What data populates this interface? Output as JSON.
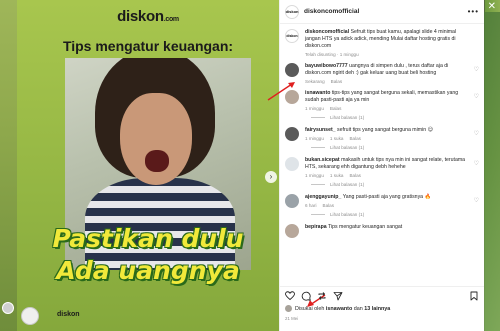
{
  "post": {
    "brand": "diskon",
    "brand_suffix": ".com",
    "headline": "Tips mengatur keuangan:",
    "caption_line1": "Pastikan dulu",
    "caption_line2": "Ada uangnya",
    "footer_brand": "diskon"
  },
  "header": {
    "username": "diskoncomofficial",
    "avatar_text": "diskon",
    "more": "•••"
  },
  "caption": {
    "username": "diskoncomofficial",
    "text": "Sefruit tips buat kamu, apalagi slide 4 minimal jangan HTS ya adick adick, mending Mulai daftar hosting gratis di diskon.com",
    "meta": "Telah disunting · 1 minggu"
  },
  "comments": [
    {
      "username": "bayuwibowo7777",
      "text": "uangnya di simpen dulu , terus daftar aja di diskon.com ngirit deh :) gak keluar uang buat beli hosting",
      "time": "Sekarang",
      "reply": "Balas",
      "likes": "",
      "replies": ""
    },
    {
      "username": "isnawanto",
      "text": "tips-tips yang sangat berguna sekali, memastikan yang sudah pasti-pasti aja ya min",
      "time": "1 minggu",
      "reply": "Balas",
      "likes": "",
      "replies": "Lihat balasan (1)"
    },
    {
      "username": "fairysunset_",
      "text": "sefruit tips yang sangat berguna mimin 😊",
      "time": "1 minggu",
      "reply": "Balas",
      "likes": "1 suka",
      "replies": "Lihat balasan (1)"
    },
    {
      "username": "bukan.sicepat",
      "text": "makasih untuk tips nya min ini sangat relate, terutama HTS, sekarang ehh digantung debh hehehe",
      "time": "1 minggu",
      "reply": "Balas",
      "likes": "1 suka",
      "replies": "Lihat balasan (1)"
    },
    {
      "username": "ajenggayunip_",
      "text": "Yang pasti-pasti aja yang gratisnya 🔥",
      "time": "6 hari",
      "reply": "Balas",
      "likes": "",
      "replies": "Lihat balasan (1)"
    },
    {
      "username": "bepirapa",
      "text": "Tips mengatur keuangan sangat",
      "time": "",
      "reply": "",
      "likes": "",
      "replies": ""
    }
  ],
  "likes": {
    "prefix": "Disukai oleh",
    "user": "isnawanto",
    "joiner": "dan",
    "others": "13 lainnya"
  },
  "date": "21 Mei",
  "colors": {
    "post_bg": "#a8c64e",
    "caption_yellow": "#f1e93a",
    "caption_outline": "#2a6a1a",
    "annotation_red": "#e02020"
  }
}
